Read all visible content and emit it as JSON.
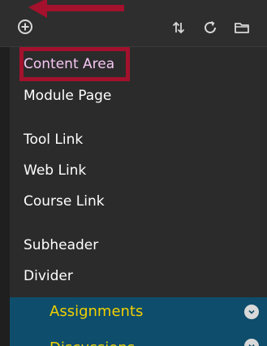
{
  "toolbar": {
    "add_icon": "plus-circle-icon",
    "sort_icon": "sort-arrows-icon",
    "refresh_icon": "refresh-icon",
    "folder_icon": "folder-icon"
  },
  "menu": {
    "items": [
      {
        "label": "Content Area"
      },
      {
        "label": "Module Page"
      },
      {
        "label": "Tool Link"
      },
      {
        "label": "Web Link"
      },
      {
        "label": "Course Link"
      },
      {
        "label": "Subheader"
      },
      {
        "label": "Divider"
      }
    ]
  },
  "course_menu": {
    "items": [
      {
        "label": "Assignments"
      },
      {
        "label": "Discussions"
      }
    ]
  },
  "colors": {
    "annotation": "#a3112c",
    "course_item_bg": "#0e4d6b",
    "course_item_text": "#f2d100",
    "highlight_text": "#f6c7f3"
  }
}
